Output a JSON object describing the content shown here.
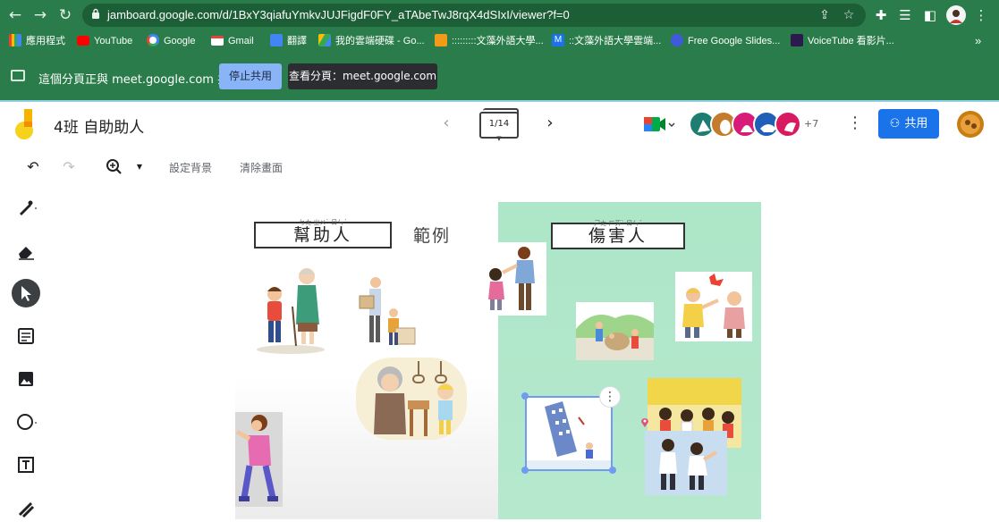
{
  "browser": {
    "url": "jamboard.google.com/d/1BxY3qiafuYmkvJUJFigdF0FY_aTAbeTwJ8rqX4dSIxI/viewer?f=0",
    "nav": {
      "back_icon": "arrow-back-icon",
      "forward_icon": "arrow-forward-icon",
      "reload_icon": "reload-icon"
    }
  },
  "bookmarks": [
    {
      "label": "應用程式",
      "icon": "apps-grid-icon"
    },
    {
      "label": "YouTube",
      "icon": "youtube-icon"
    },
    {
      "label": "Google",
      "icon": "google-icon"
    },
    {
      "label": "Gmail",
      "icon": "gmail-icon"
    },
    {
      "label": "翻譯",
      "icon": "translate-icon"
    },
    {
      "label": "我的雲端硬碟 - Go...",
      "icon": "drive-icon"
    },
    {
      "label": ":::::::::文藻外語大學...",
      "icon": "rss-icon"
    },
    {
      "label": "::文藻外語大學雲端...",
      "icon": "m-logo-icon"
    },
    {
      "label": "Free Google Slides...",
      "icon": "slides-icon"
    },
    {
      "label": "VoiceTube 看影片...",
      "icon": "voicetube-icon"
    }
  ],
  "share_bar": {
    "message": "這個分頁正與 meet.google.com 共用",
    "stop_label": "停止共用",
    "view_label": "查看分頁：meet.google.com"
  },
  "jamboard": {
    "title": "4班 自助助人",
    "frame_counter": "1/14",
    "collaborators_extra": "+7",
    "share_label": "共用",
    "toolbar": {
      "set_background": "設定背景",
      "clear_frame": "清除畫面"
    },
    "tools": [
      "pen-icon",
      "eraser-icon",
      "select-icon",
      "sticky-note-icon",
      "image-icon",
      "circle-icon",
      "text-box-icon",
      "laser-icon"
    ],
    "active_tool": "select-icon"
  },
  "canvas": {
    "left_heading": "幫助人",
    "left_heading_ruby": "ㄅㄤ ㄓㄨˋ ㄖㄣˊ",
    "example_label": "範例",
    "right_heading": "傷害人",
    "right_heading_ruby": "ㄕㄤ ㄏㄞˋ ㄖㄣˊ"
  },
  "colors": {
    "chrome": "#2a7d4a",
    "accent_blue": "#1a73e8",
    "selection_blue": "#6f9cf0",
    "canvas_green": "#ade6c8"
  }
}
